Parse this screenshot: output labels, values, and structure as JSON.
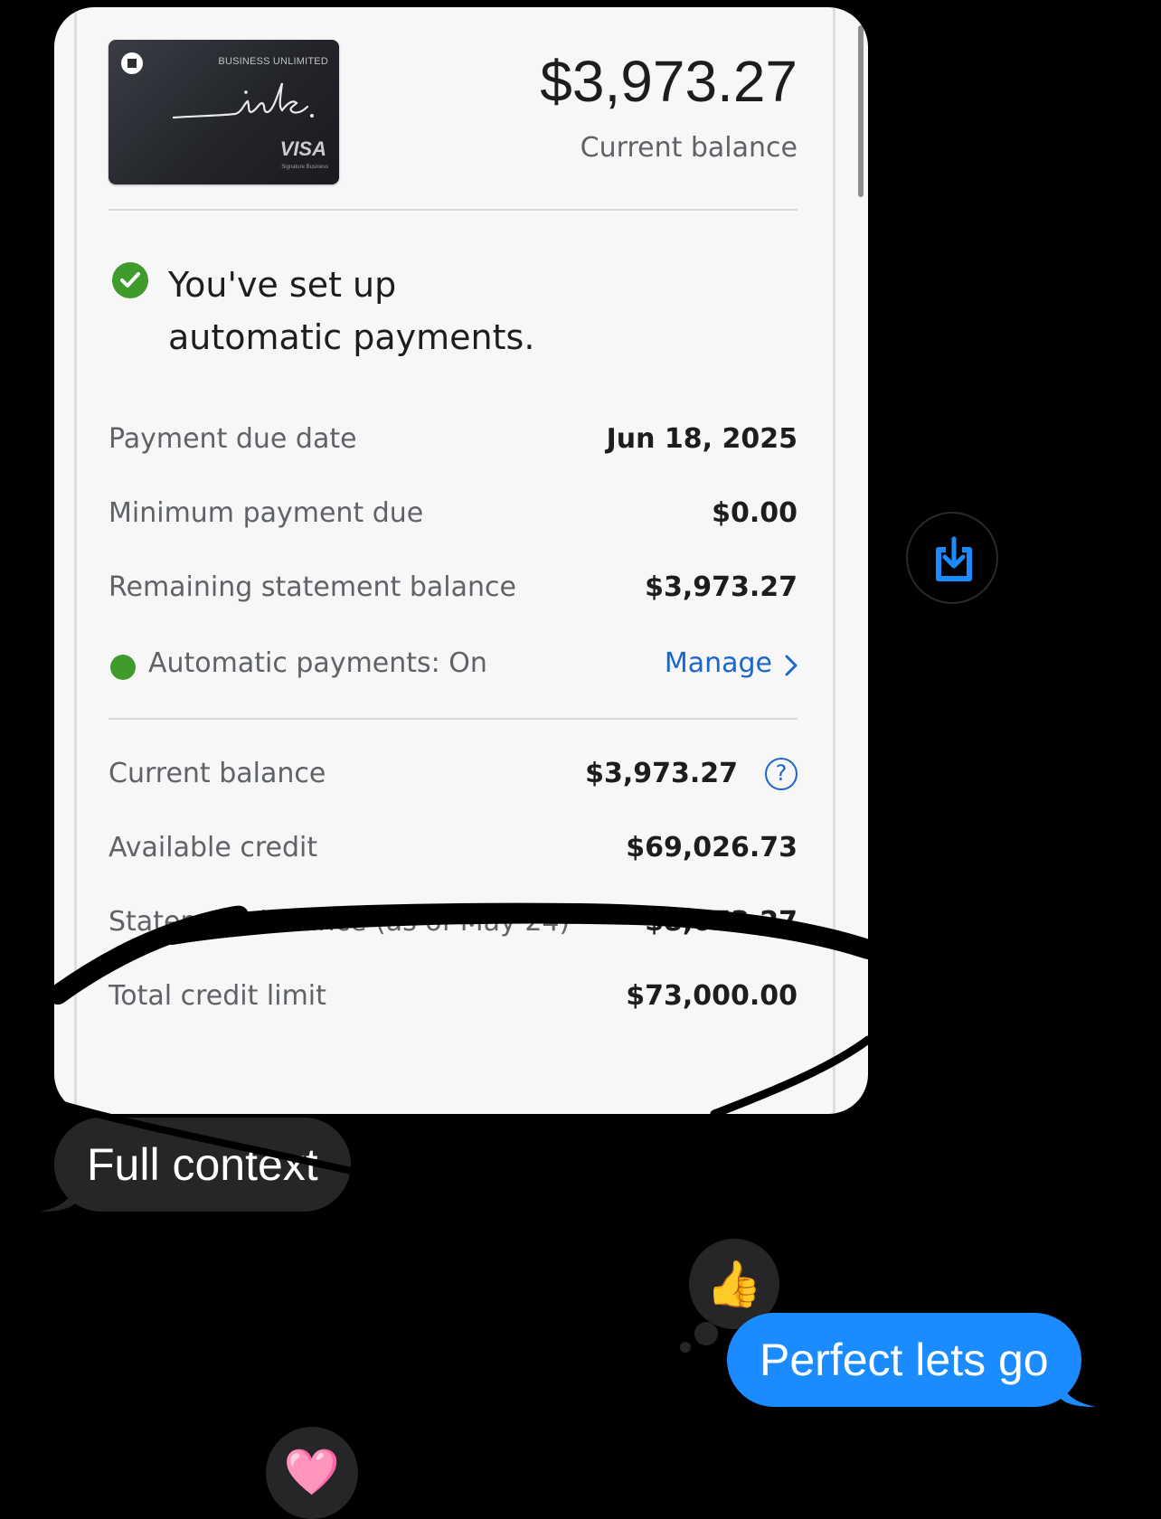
{
  "card_image": {
    "card_tier": "BUSINESS UNLIMITED",
    "card_brand_script": "ink.",
    "card_network": "VISA",
    "card_network_sub": "Signature Business",
    "balance_amount": "$3,973.27",
    "balance_label": "Current balance",
    "autopay_message": "You've set up automatic payments.",
    "autopay_line1": "You've set up",
    "autopay_line2": "automatic payments.",
    "rows_top": [
      {
        "label": "Payment due date",
        "value": "Jun 18, 2025"
      },
      {
        "label": "Minimum payment due",
        "value": "$0.00"
      },
      {
        "label": "Remaining statement balance",
        "value": "$3,973.27"
      }
    ],
    "autopay_status": "Automatic payments: On",
    "manage_label": "Manage",
    "rows_bottom": [
      {
        "label": "Current balance",
        "value": "$3,973.27"
      },
      {
        "label": "Available credit",
        "value": "$69,026.73"
      },
      {
        "label": "Statement balance (as of May 24)",
        "value": "$8,073.27"
      },
      {
        "label": "Total credit limit",
        "value": "$73,000.00"
      }
    ],
    "help_glyph": "?"
  },
  "messages": [
    {
      "direction": "incoming",
      "text": "Full context"
    },
    {
      "direction": "outgoing",
      "text": "Perfect lets go"
    }
  ],
  "tapbacks": {
    "outgoing_reaction": "👍",
    "incoming_reaction": "🩷"
  },
  "colors": {
    "outgoing_bubble": "#1a8cff",
    "incoming_bubble": "#262628",
    "link_blue": "#1b66c9",
    "status_green": "#3f9b2b"
  },
  "icons": [
    "chase-octagon-icon",
    "check-circle-icon",
    "status-dot-icon",
    "chevron-right-icon",
    "help-circle-icon",
    "save-download-icon"
  ]
}
